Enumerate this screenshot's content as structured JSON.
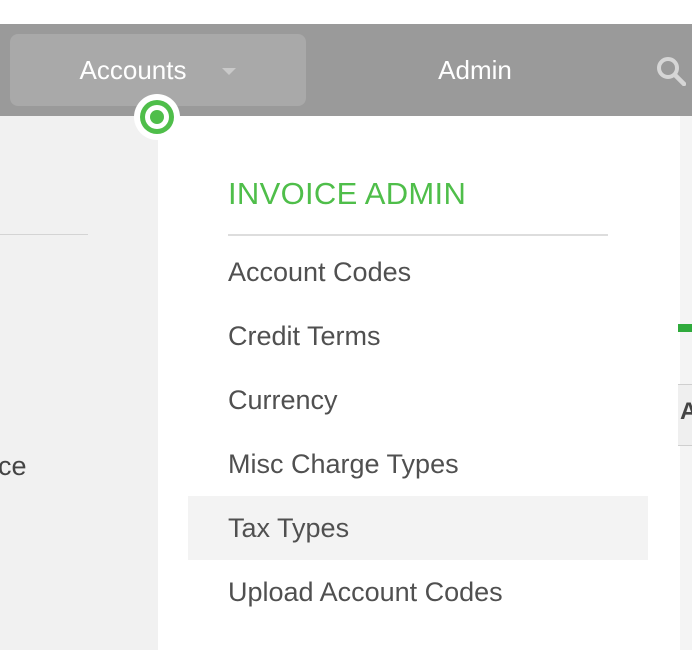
{
  "nav": {
    "accounts_label": "Accounts",
    "admin_label": "Admin",
    "search_icon": "search-icon",
    "caret_icon": "chevron-down-icon"
  },
  "background": {
    "left_text_fragment": "ce",
    "right_text_fragment": "A"
  },
  "dropdown": {
    "section_title": "INVOICE ADMIN",
    "items": [
      {
        "label": "Account Codes"
      },
      {
        "label": "Credit Terms"
      },
      {
        "label": "Currency"
      },
      {
        "label": "Misc Charge Types"
      },
      {
        "label": "Tax Types",
        "hovered": true
      },
      {
        "label": "Upload Account Codes"
      }
    ]
  },
  "colors": {
    "accent_green": "#4fbe4a",
    "nav_bg": "#9a9a9a",
    "nav_active_bg": "#a9a9a9",
    "text_dark": "#505050"
  }
}
